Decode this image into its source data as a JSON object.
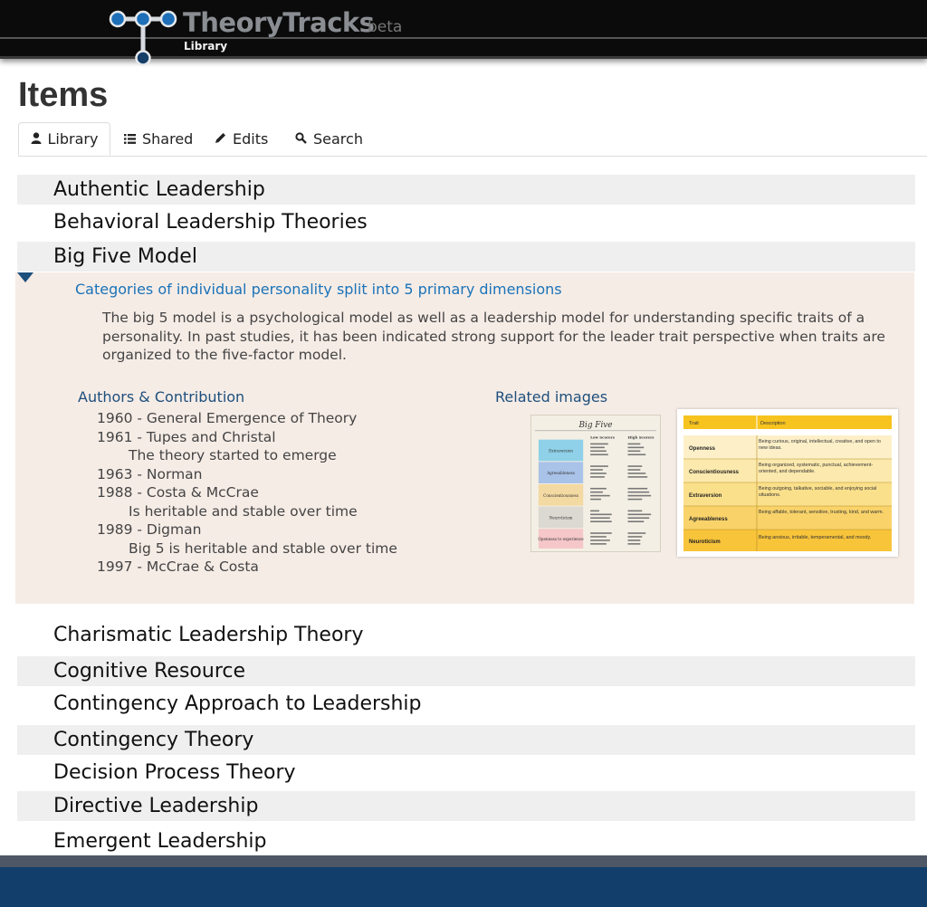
{
  "header": {
    "brand": "TheoryTracks",
    "beta": "beta",
    "section": "Library"
  },
  "page": {
    "title": "Items"
  },
  "tabs": [
    {
      "label": "Library",
      "icon": "user-icon",
      "active": true
    },
    {
      "label": "Shared",
      "icon": "list-icon",
      "active": false
    },
    {
      "label": "Edits",
      "icon": "pencil-icon",
      "active": false
    },
    {
      "label": "Search",
      "icon": "search-icon",
      "active": false
    }
  ],
  "items_before": [
    "Authentic Leadership",
    "Behavioral Leadership Theories",
    "Big Five Model"
  ],
  "expanded": {
    "summary": "Categories of individual personality split into 5 primary dimensions",
    "description": "The big 5 model is a psychological model as well as a leadership model for understanding specific traits of a personality. In past studies, it has been indicated strong support for the leader trait perspective when traits are organized to the five-factor model.",
    "authors_heading": "Authors & Contribution",
    "contributions": [
      {
        "text": "1960 - General Emergence of Theory",
        "indent": false
      },
      {
        "text": "1961 - Tupes and Christal",
        "indent": false
      },
      {
        "text": "The theory started to emerge",
        "indent": true
      },
      {
        "text": "1963 - Norman",
        "indent": false
      },
      {
        "text": "1988 - Costa & McCrae",
        "indent": false
      },
      {
        "text": "Is heritable and stable over time",
        "indent": true
      },
      {
        "text": "1989 - Digman",
        "indent": false
      },
      {
        "text": "Big 5 is heritable and stable over time",
        "indent": true
      },
      {
        "text": "1997 - McCrae & Costa",
        "indent": false
      }
    ],
    "images_heading": "Related images",
    "image1": {
      "title": "Big Five",
      "col_low": "Low Scorers",
      "col_high": "High Scorers",
      "rows": [
        "Extraversion",
        "Agreeableness",
        "Conscientiousness",
        "Neuroticism",
        "Openness to experience"
      ]
    },
    "image2": {
      "col_trait": "Trait",
      "col_desc": "Description",
      "rows": [
        {
          "trait": "Openness",
          "desc": "Being curious, original, intellectual, creative, and open to new ideas."
        },
        {
          "trait": "Conscientiousness",
          "desc": "Being organized, systematic, punctual, achievement-oriented, and dependable."
        },
        {
          "trait": "Extraversion",
          "desc": "Being outgoing, talkative, sociable, and enjoying social situations."
        },
        {
          "trait": "Agreeableness",
          "desc": "Being affable, tolerant, sensitive, trusting, kind, and warm."
        },
        {
          "trait": "Neuroticism",
          "desc": "Being anxious, irritable, temperamental, and moody."
        }
      ]
    }
  },
  "items_after": [
    "Charismatic Leadership Theory",
    "Cognitive Resource",
    "Contingency Approach to Leadership",
    "Contingency Theory",
    "Decision Process Theory",
    "Directive Leadership",
    "Emergent Leadership"
  ],
  "colors": {
    "accent_blue": "#1a73b8",
    "heading_blue": "#1d4f7c",
    "footer_blue": "#113e6b",
    "detail_bg": "#f6ece6",
    "row_shade": "#efefef"
  }
}
